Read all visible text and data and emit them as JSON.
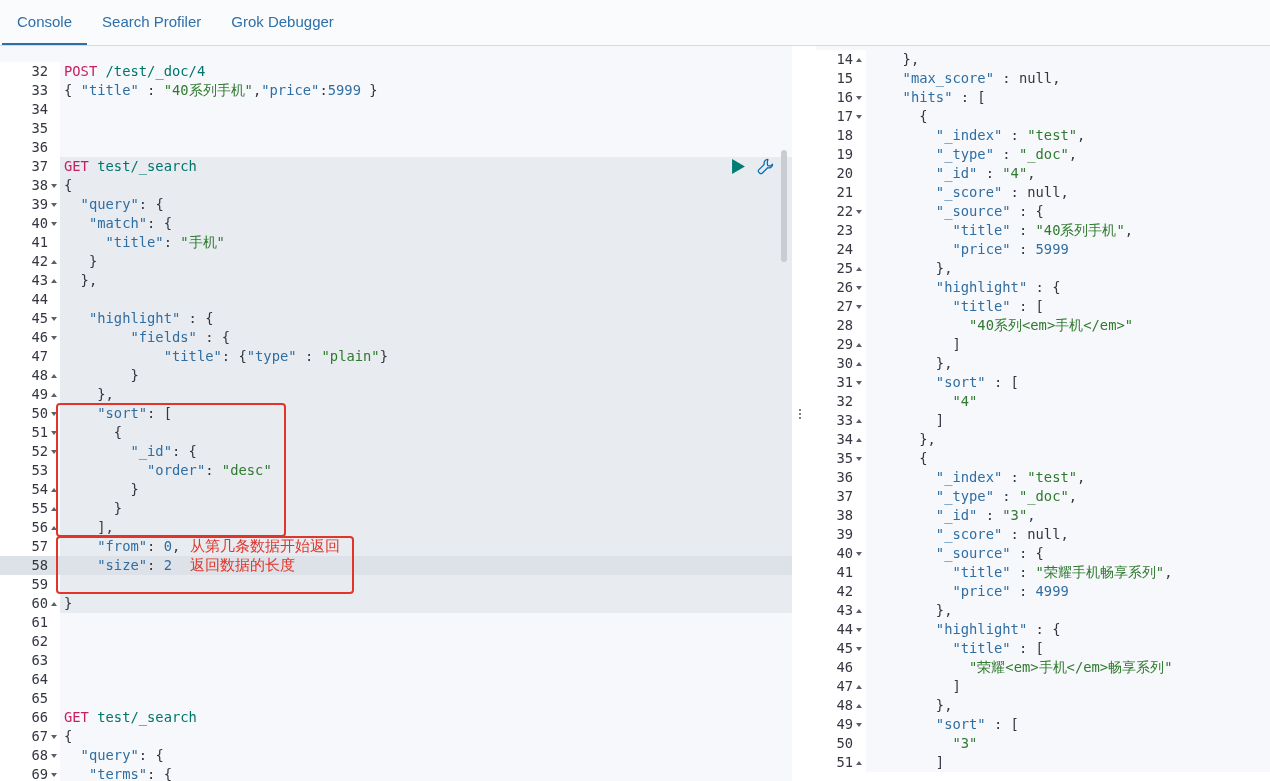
{
  "tabs": [
    {
      "label": "Console",
      "selected": true
    },
    {
      "label": "Search Profiler",
      "selected": false
    },
    {
      "label": "Grok Debugger",
      "selected": false
    }
  ],
  "request_editor": {
    "blocks": [
      {
        "kind": "plain",
        "lines": [
          {
            "number": "32",
            "kind": "plain",
            "active": false,
            "tokens": [
              {
                "kind": "method",
                "text": "POST"
              },
              {
                "kind": "path",
                "text": " /test/_doc/4"
              }
            ]
          },
          {
            "number": "33",
            "kind": "plain",
            "active": false,
            "tokens": [
              {
                "kind": "punct",
                "text": "{ "
              },
              {
                "kind": "key",
                "text": "\"title\""
              },
              {
                "kind": "punct",
                "text": " : "
              },
              {
                "kind": "string",
                "text": "\"40系列手机\""
              },
              {
                "kind": "punct",
                "text": ","
              },
              {
                "kind": "key",
                "text": "\"price\""
              },
              {
                "kind": "punct",
                "text": ":"
              },
              {
                "kind": "number",
                "text": "5999"
              },
              {
                "kind": "punct",
                "text": " }"
              }
            ]
          },
          {
            "number": "34",
            "kind": "plain",
            "active": false
          },
          {
            "number": "35",
            "kind": "plain",
            "active": false
          },
          {
            "number": "36",
            "kind": "plain",
            "active": false
          }
        ]
      },
      {
        "kind": "request",
        "blocks": [
          {
            "kind": "plain",
            "lines": [
              {
                "number": "37",
                "kind": "plain",
                "active": false,
                "tokens": [
                  {
                    "kind": "method",
                    "text": "GET"
                  },
                  {
                    "kind": "path",
                    "text": " test/_search"
                  }
                ]
              },
              {
                "number": "38",
                "kind": "open",
                "active": false,
                "tokens": [
                  {
                    "kind": "punct",
                    "text": "{"
                  }
                ]
              },
              {
                "number": "39",
                "kind": "open",
                "active": false,
                "tokens": [
                  {
                    "kind": "key",
                    "text": "  \"query\""
                  },
                  {
                    "kind": "punct",
                    "text": ": {"
                  }
                ]
              },
              {
                "number": "40",
                "kind": "open",
                "active": false,
                "tokens": [
                  {
                    "kind": "key",
                    "text": "   \"match\""
                  },
                  {
                    "kind": "punct",
                    "text": ": {"
                  }
                ]
              },
              {
                "number": "41",
                "kind": "plain",
                "active": false,
                "tokens": [
                  {
                    "kind": "key",
                    "text": "     \"title\""
                  },
                  {
                    "kind": "punct",
                    "text": ": "
                  },
                  {
                    "kind": "string",
                    "text": "\"手机\""
                  }
                ]
              },
              {
                "number": "42",
                "kind": "close",
                "active": false,
                "tokens": [
                  {
                    "kind": "punct",
                    "text": "   }"
                  }
                ]
              },
              {
                "number": "43",
                "kind": "close",
                "active": false,
                "tokens": [
                  {
                    "kind": "punct",
                    "text": "  },"
                  }
                ]
              },
              {
                "number": "44",
                "kind": "plain",
                "active": false
              },
              {
                "number": "45",
                "kind": "open",
                "active": false,
                "tokens": [
                  {
                    "kind": "key",
                    "text": "   \"highlight\""
                  },
                  {
                    "kind": "punct",
                    "text": " : {"
                  }
                ]
              },
              {
                "number": "46",
                "kind": "open",
                "active": false,
                "tokens": [
                  {
                    "kind": "key",
                    "text": "        \"fields\""
                  },
                  {
                    "kind": "punct",
                    "text": " : {"
                  }
                ]
              },
              {
                "number": "47",
                "kind": "plain",
                "active": false,
                "tokens": [
                  {
                    "kind": "key",
                    "text": "            \"title\""
                  },
                  {
                    "kind": "punct",
                    "text": ": {"
                  },
                  {
                    "kind": "key",
                    "text": "\"type\""
                  },
                  {
                    "kind": "punct",
                    "text": " : "
                  },
                  {
                    "kind": "string",
                    "text": "\"plain\""
                  },
                  {
                    "kind": "punct",
                    "text": "}"
                  }
                ]
              },
              {
                "number": "48",
                "kind": "close",
                "active": false,
                "tokens": [
                  {
                    "kind": "punct",
                    "text": "        }"
                  }
                ]
              },
              {
                "number": "49",
                "kind": "close",
                "active": false,
                "tokens": [
                  {
                    "kind": "punct",
                    "text": "    },"
                  }
                ]
              }
            ]
          },
          {
            "kind": "box",
            "lines": [
              {
                "number": "50",
                "kind": "open",
                "active": false,
                "tokens": [
                  {
                    "kind": "key",
                    "text": "    \"sort\""
                  },
                  {
                    "kind": "punct",
                    "text": ": ["
                  }
                ]
              },
              {
                "number": "51",
                "kind": "open",
                "active": false,
                "tokens": [
                  {
                    "kind": "punct",
                    "text": "      {"
                  }
                ]
              },
              {
                "number": "52",
                "kind": "open",
                "active": false,
                "tokens": [
                  {
                    "kind": "key",
                    "text": "        \"_id\""
                  },
                  {
                    "kind": "punct",
                    "text": ": {"
                  }
                ]
              },
              {
                "number": "53",
                "kind": "plain",
                "active": false,
                "tokens": [
                  {
                    "kind": "key",
                    "text": "          \"order\""
                  },
                  {
                    "kind": "punct",
                    "text": ": "
                  },
                  {
                    "kind": "string",
                    "text": "\"desc\""
                  }
                ]
              },
              {
                "number": "54",
                "kind": "close",
                "active": false,
                "tokens": [
                  {
                    "kind": "punct",
                    "text": "        }"
                  }
                ]
              },
              {
                "number": "55",
                "kind": "close",
                "active": false,
                "tokens": [
                  {
                    "kind": "punct",
                    "text": "      }"
                  }
                ]
              },
              {
                "number": "56",
                "kind": "close",
                "active": false,
                "tokens": [
                  {
                    "kind": "punct",
                    "text": "    ],"
                  }
                ]
              }
            ]
          },
          {
            "kind": "box",
            "lines": [
              {
                "number": "57",
                "kind": "plain",
                "active": false,
                "note": "从第几条数据开始返回",
                "tokens": [
                  {
                    "kind": "key",
                    "text": "    \"from\""
                  },
                  {
                    "kind": "punct",
                    "text": ": "
                  },
                  {
                    "kind": "number",
                    "text": "0"
                  },
                  {
                    "kind": "punct",
                    "text": ","
                  }
                ]
              },
              {
                "number": "58",
                "kind": "plain",
                "active": true,
                "note": "返回数据的长度",
                "tokens": [
                  {
                    "kind": "key",
                    "text": "    \"size\""
                  },
                  {
                    "kind": "punct",
                    "text": ": "
                  },
                  {
                    "kind": "number",
                    "text": "2"
                  }
                ]
              },
              {
                "number": "59",
                "kind": "plain",
                "active": false
              }
            ]
          },
          {
            "kind": "plain",
            "lines": [
              {
                "number": "60",
                "kind": "close",
                "active": false,
                "tokens": [
                  {
                    "kind": "punct",
                    "text": "}"
                  }
                ]
              }
            ]
          }
        ]
      },
      {
        "kind": "plain",
        "lines": [
          {
            "number": "61",
            "kind": "plain",
            "active": false
          },
          {
            "number": "62",
            "kind": "plain",
            "active": false
          },
          {
            "number": "63",
            "kind": "plain",
            "active": false
          },
          {
            "number": "64",
            "kind": "plain",
            "active": false
          },
          {
            "number": "65",
            "kind": "plain",
            "active": false
          },
          {
            "number": "66",
            "kind": "plain",
            "active": false,
            "tokens": [
              {
                "kind": "method",
                "text": "GET"
              },
              {
                "kind": "path",
                "text": " test/_search"
              }
            ]
          },
          {
            "number": "67",
            "kind": "open",
            "active": false,
            "tokens": [
              {
                "kind": "punct",
                "text": "{"
              }
            ]
          },
          {
            "number": "68",
            "kind": "open",
            "active": false,
            "tokens": [
              {
                "kind": "key",
                "text": "  \"query\""
              },
              {
                "kind": "punct",
                "text": ": {"
              }
            ]
          },
          {
            "number": "69",
            "kind": "open",
            "active": false,
            "tokens": [
              {
                "kind": "key",
                "text": "   \"terms\""
              },
              {
                "kind": "punct",
                "text": ": {"
              }
            ]
          }
        ]
      }
    ]
  },
  "response_viewer": {
    "lines": [
      {
        "number": "14",
        "kind": "close",
        "tokens": [
          {
            "kind": "punct",
            "text": "  },"
          }
        ]
      },
      {
        "number": "15",
        "kind": "plain",
        "tokens": [
          {
            "kind": "key",
            "text": "  \"max_score\""
          },
          {
            "kind": "punct",
            "text": " : "
          },
          {
            "kind": "literal",
            "text": "null"
          },
          {
            "kind": "punct",
            "text": ","
          }
        ]
      },
      {
        "number": "16",
        "kind": "open",
        "tokens": [
          {
            "kind": "key",
            "text": "  \"hits\""
          },
          {
            "kind": "punct",
            "text": " : ["
          }
        ]
      },
      {
        "number": "17",
        "kind": "open",
        "tokens": [
          {
            "kind": "punct",
            "text": "    {"
          }
        ]
      },
      {
        "number": "18",
        "kind": "plain",
        "tokens": [
          {
            "kind": "key",
            "text": "      \"_index\""
          },
          {
            "kind": "punct",
            "text": " : "
          },
          {
            "kind": "string",
            "text": "\"test\""
          },
          {
            "kind": "punct",
            "text": ","
          }
        ]
      },
      {
        "number": "19",
        "kind": "plain",
        "tokens": [
          {
            "kind": "key",
            "text": "      \"_type\""
          },
          {
            "kind": "punct",
            "text": " : "
          },
          {
            "kind": "string",
            "text": "\"_doc\""
          },
          {
            "kind": "punct",
            "text": ","
          }
        ]
      },
      {
        "number": "20",
        "kind": "plain",
        "tokens": [
          {
            "kind": "key",
            "text": "      \"_id\""
          },
          {
            "kind": "punct",
            "text": " : "
          },
          {
            "kind": "string",
            "text": "\"4\""
          },
          {
            "kind": "punct",
            "text": ","
          }
        ]
      },
      {
        "number": "21",
        "kind": "plain",
        "tokens": [
          {
            "kind": "key",
            "text": "      \"_score\""
          },
          {
            "kind": "punct",
            "text": " : "
          },
          {
            "kind": "literal",
            "text": "null"
          },
          {
            "kind": "punct",
            "text": ","
          }
        ]
      },
      {
        "number": "22",
        "kind": "open",
        "tokens": [
          {
            "kind": "key",
            "text": "      \"_source\""
          },
          {
            "kind": "punct",
            "text": " : {"
          }
        ]
      },
      {
        "number": "23",
        "kind": "plain",
        "tokens": [
          {
            "kind": "key",
            "text": "        \"title\""
          },
          {
            "kind": "punct",
            "text": " : "
          },
          {
            "kind": "string",
            "text": "\"40系列手机\""
          },
          {
            "kind": "punct",
            "text": ","
          }
        ]
      },
      {
        "number": "24",
        "kind": "plain",
        "tokens": [
          {
            "kind": "key",
            "text": "        \"price\""
          },
          {
            "kind": "punct",
            "text": " : "
          },
          {
            "kind": "number",
            "text": "5999"
          }
        ]
      },
      {
        "number": "25",
        "kind": "close",
        "tokens": [
          {
            "kind": "punct",
            "text": "      },"
          }
        ]
      },
      {
        "number": "26",
        "kind": "open",
        "tokens": [
          {
            "kind": "key",
            "text": "      \"highlight\""
          },
          {
            "kind": "punct",
            "text": " : {"
          }
        ]
      },
      {
        "number": "27",
        "kind": "open",
        "tokens": [
          {
            "kind": "key",
            "text": "        \"title\""
          },
          {
            "kind": "punct",
            "text": " : ["
          }
        ]
      },
      {
        "number": "28",
        "kind": "plain",
        "tokens": [
          {
            "kind": "string",
            "text": "          \"40系列<em>手机</em>\""
          }
        ]
      },
      {
        "number": "29",
        "kind": "close",
        "tokens": [
          {
            "kind": "punct",
            "text": "        ]"
          }
        ]
      },
      {
        "number": "30",
        "kind": "close",
        "tokens": [
          {
            "kind": "punct",
            "text": "      },"
          }
        ]
      },
      {
        "number": "31",
        "kind": "open",
        "tokens": [
          {
            "kind": "key",
            "text": "      \"sort\""
          },
          {
            "kind": "punct",
            "text": " : ["
          }
        ]
      },
      {
        "number": "32",
        "kind": "plain",
        "tokens": [
          {
            "kind": "string",
            "text": "        \"4\""
          }
        ]
      },
      {
        "number": "33",
        "kind": "close",
        "tokens": [
          {
            "kind": "punct",
            "text": "      ]"
          }
        ]
      },
      {
        "number": "34",
        "kind": "close",
        "tokens": [
          {
            "kind": "punct",
            "text": "    },"
          }
        ]
      },
      {
        "number": "35",
        "kind": "open",
        "tokens": [
          {
            "kind": "punct",
            "text": "    {"
          }
        ]
      },
      {
        "number": "36",
        "kind": "plain",
        "tokens": [
          {
            "kind": "key",
            "text": "      \"_index\""
          },
          {
            "kind": "punct",
            "text": " : "
          },
          {
            "kind": "string",
            "text": "\"test\""
          },
          {
            "kind": "punct",
            "text": ","
          }
        ]
      },
      {
        "number": "37",
        "kind": "plain",
        "tokens": [
          {
            "kind": "key",
            "text": "      \"_type\""
          },
          {
            "kind": "punct",
            "text": " : "
          },
          {
            "kind": "string",
            "text": "\"_doc\""
          },
          {
            "kind": "punct",
            "text": ","
          }
        ]
      },
      {
        "number": "38",
        "kind": "plain",
        "tokens": [
          {
            "kind": "key",
            "text": "      \"_id\""
          },
          {
            "kind": "punct",
            "text": " : "
          },
          {
            "kind": "string",
            "text": "\"3\""
          },
          {
            "kind": "punct",
            "text": ","
          }
        ]
      },
      {
        "number": "39",
        "kind": "plain",
        "tokens": [
          {
            "kind": "key",
            "text": "      \"_score\""
          },
          {
            "kind": "punct",
            "text": " : "
          },
          {
            "kind": "literal",
            "text": "null"
          },
          {
            "kind": "punct",
            "text": ","
          }
        ]
      },
      {
        "number": "40",
        "kind": "open",
        "tokens": [
          {
            "kind": "key",
            "text": "      \"_source\""
          },
          {
            "kind": "punct",
            "text": " : {"
          }
        ]
      },
      {
        "number": "41",
        "kind": "plain",
        "tokens": [
          {
            "kind": "key",
            "text": "        \"title\""
          },
          {
            "kind": "punct",
            "text": " : "
          },
          {
            "kind": "string",
            "text": "\"荣耀手机畅享系列\""
          },
          {
            "kind": "punct",
            "text": ","
          }
        ]
      },
      {
        "number": "42",
        "kind": "plain",
        "tokens": [
          {
            "kind": "key",
            "text": "        \"price\""
          },
          {
            "kind": "punct",
            "text": " : "
          },
          {
            "kind": "number",
            "text": "4999"
          }
        ]
      },
      {
        "number": "43",
        "kind": "close",
        "tokens": [
          {
            "kind": "punct",
            "text": "      },"
          }
        ]
      },
      {
        "number": "44",
        "kind": "open",
        "tokens": [
          {
            "kind": "key",
            "text": "      \"highlight\""
          },
          {
            "kind": "punct",
            "text": " : {"
          }
        ]
      },
      {
        "number": "45",
        "kind": "open",
        "tokens": [
          {
            "kind": "key",
            "text": "        \"title\""
          },
          {
            "kind": "punct",
            "text": " : ["
          }
        ]
      },
      {
        "number": "46",
        "kind": "plain",
        "tokens": [
          {
            "kind": "string",
            "text": "          \"荣耀<em>手机</em>畅享系列\""
          }
        ]
      },
      {
        "number": "47",
        "kind": "close",
        "tokens": [
          {
            "kind": "punct",
            "text": "        ]"
          }
        ]
      },
      {
        "number": "48",
        "kind": "close",
        "tokens": [
          {
            "kind": "punct",
            "text": "      },"
          }
        ]
      },
      {
        "number": "49",
        "kind": "open",
        "tokens": [
          {
            "kind": "key",
            "text": "      \"sort\""
          },
          {
            "kind": "punct",
            "text": " : ["
          }
        ]
      },
      {
        "number": "50",
        "kind": "plain",
        "tokens": [
          {
            "kind": "string",
            "text": "        \"3\""
          }
        ]
      },
      {
        "number": "51",
        "kind": "close",
        "tokens": [
          {
            "kind": "punct",
            "text": "      ]"
          }
        ]
      }
    ]
  }
}
